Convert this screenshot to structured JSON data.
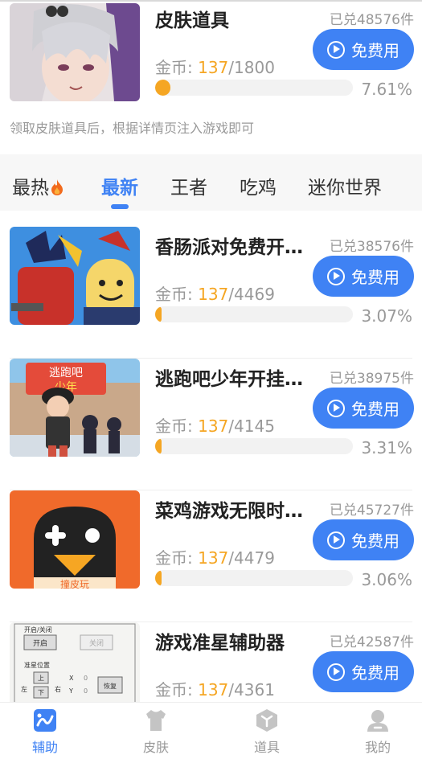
{
  "featured": {
    "title": "皮肤道具",
    "sold": "已兑48576件",
    "button": "免费用",
    "coins_label": "金币: ",
    "coins_current": "137",
    "coins_total": "/1800",
    "progress": 0.0761,
    "percent": "7.61%",
    "notice": "领取皮肤道具后，根据详情页注入游戏即可"
  },
  "tabs": [
    {
      "label": "最热",
      "icon": "flame-icon"
    },
    {
      "label": "最新",
      "active": true
    },
    {
      "label": "王者"
    },
    {
      "label": "吃鸡"
    },
    {
      "label": "迷你世界"
    }
  ],
  "items": [
    {
      "title": "香肠派对免费开…",
      "sold": "已兑38576件",
      "button": "免费用",
      "coins_label": "金币: ",
      "coins_current": "137",
      "coins_total": "/4469",
      "progress": 0.0307,
      "percent": "3.07%"
    },
    {
      "title": "逃跑吧少年开挂…",
      "sold": "已兑38975件",
      "button": "免费用",
      "coins_label": "金币: ",
      "coins_current": "137",
      "coins_total": "/4145",
      "progress": 0.0331,
      "percent": "3.31%"
    },
    {
      "title": "菜鸡游戏无限时…",
      "sold": "已兑45727件",
      "button": "免费用",
      "coins_label": "金币: ",
      "coins_current": "137",
      "coins_total": "/4479",
      "progress": 0.0306,
      "percent": "3.06%"
    },
    {
      "title": "游戏准星辅助器",
      "sold": "已兑42587件",
      "button": "免费用",
      "coins_label": "金币: ",
      "coins_current": "137",
      "coins_total": "/4361",
      "progress": 0.0314,
      "percent": ""
    }
  ],
  "thumb_text": {
    "item1_top": "逃跑吧",
    "item1_sub": "少年",
    "item3_logo": "撞皮玩",
    "item4_open_close": "开启/关闭",
    "item4_open": "开启",
    "item4_close": "关闭",
    "item4_crosshair": "准星位置",
    "item4_up": "上",
    "item4_left": "左",
    "item4_right": "右",
    "item4_down": "下",
    "item4_x": "X",
    "item4_y": "Y",
    "item4_zero": "0",
    "item4_reset": "恢复"
  },
  "bottom_nav": [
    {
      "label": "辅助",
      "icon": "assist-icon",
      "active": true
    },
    {
      "label": "皮肤",
      "icon": "tshirt-icon"
    },
    {
      "label": "道具",
      "icon": "box-icon"
    },
    {
      "label": "我的",
      "icon": "user-icon"
    }
  ],
  "colors": {
    "accent": "#3f82f4",
    "gold": "#f5a623"
  }
}
